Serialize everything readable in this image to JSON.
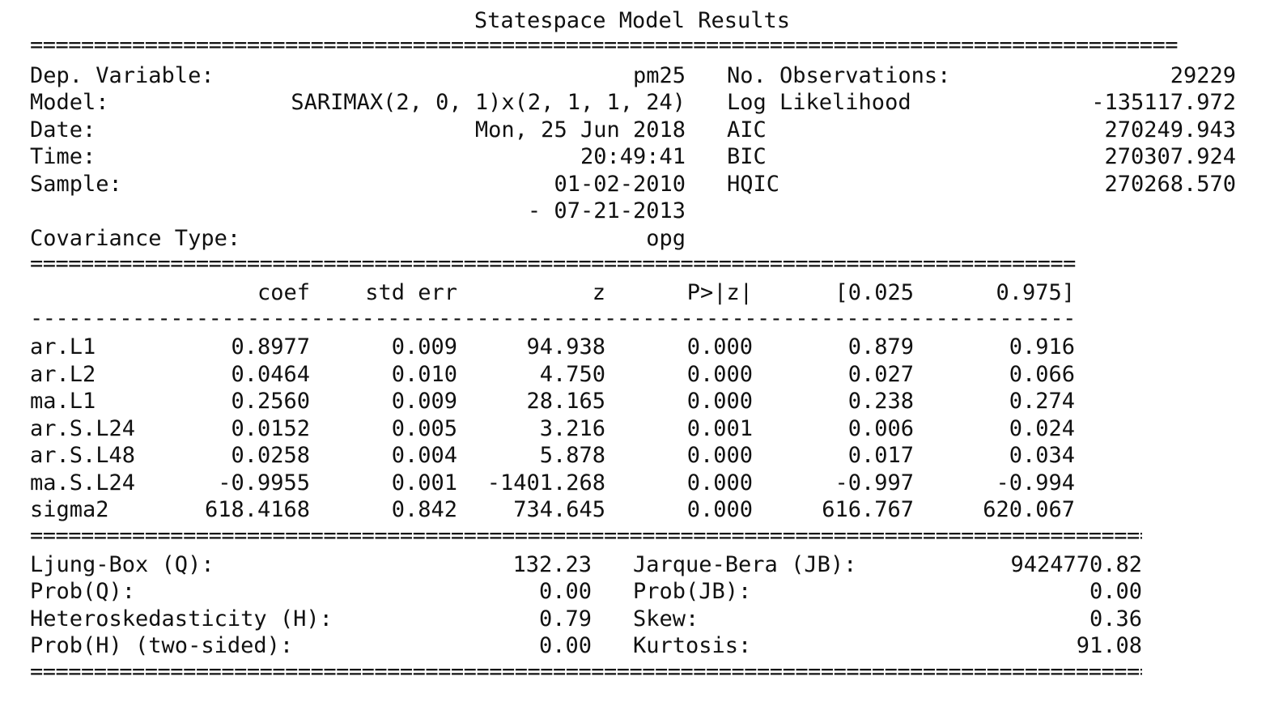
{
  "title": "Statespace Model Results",
  "separators": {
    "double": "==========================================================================================",
    "single": "------------------------------------------------------------------------------------------"
  },
  "header_left": [
    {
      "label": "Dep. Variable:",
      "value": "pm25"
    },
    {
      "label": "Model:",
      "value": "SARIMAX(2, 0, 1)x(2, 1, 1, 24)"
    },
    {
      "label": "Date:",
      "value": "Mon, 25 Jun 2018"
    },
    {
      "label": "Time:",
      "value": "20:49:41"
    },
    {
      "label": "Sample:",
      "value": "01-02-2010"
    },
    {
      "label": "",
      "value": "- 07-21-2013"
    },
    {
      "label": "Covariance Type:",
      "value": "opg"
    }
  ],
  "header_right": [
    {
      "label": "No. Observations:",
      "value": "29229"
    },
    {
      "label": "Log Likelihood",
      "value": "-135117.972"
    },
    {
      "label": "AIC",
      "value": "270249.943"
    },
    {
      "label": "BIC",
      "value": "270307.924"
    },
    {
      "label": "HQIC",
      "value": "270268.570"
    }
  ],
  "coef_table": {
    "columns": [
      "coef",
      "std err",
      "z",
      "P>|z|",
      "[0.025",
      "0.975]"
    ],
    "rows": [
      {
        "name": "ar.L1",
        "values": [
          "0.8977",
          "0.009",
          "94.938",
          "0.000",
          "0.879",
          "0.916"
        ]
      },
      {
        "name": "ar.L2",
        "values": [
          "0.0464",
          "0.010",
          "4.750",
          "0.000",
          "0.027",
          "0.066"
        ]
      },
      {
        "name": "ma.L1",
        "values": [
          "0.2560",
          "0.009",
          "28.165",
          "0.000",
          "0.238",
          "0.274"
        ]
      },
      {
        "name": "ar.S.L24",
        "values": [
          "0.0152",
          "0.005",
          "3.216",
          "0.001",
          "0.006",
          "0.024"
        ]
      },
      {
        "name": "ar.S.L48",
        "values": [
          "0.0258",
          "0.004",
          "5.878",
          "0.000",
          "0.017",
          "0.034"
        ]
      },
      {
        "name": "ma.S.L24",
        "values": [
          "-0.9955",
          "0.001",
          "-1401.268",
          "0.000",
          "-0.997",
          "-0.994"
        ]
      },
      {
        "name": "sigma2",
        "values": [
          "618.4168",
          "0.842",
          "734.645",
          "0.000",
          "616.767",
          "620.067"
        ]
      }
    ]
  },
  "diagnostics_left": [
    {
      "label": "Ljung-Box (Q):",
      "value": "132.23"
    },
    {
      "label": "Prob(Q):",
      "value": "0.00"
    },
    {
      "label": "Heteroskedasticity (H):",
      "value": "0.79"
    },
    {
      "label": "Prob(H) (two-sided):",
      "value": "0.00"
    }
  ],
  "diagnostics_right": [
    {
      "label": "Jarque-Bera (JB):",
      "value": "9424770.82"
    },
    {
      "label": "Prob(JB):",
      "value": "0.00"
    },
    {
      "label": "Skew:",
      "value": "0.36"
    },
    {
      "label": "Kurtosis:",
      "value": "91.08"
    }
  ]
}
